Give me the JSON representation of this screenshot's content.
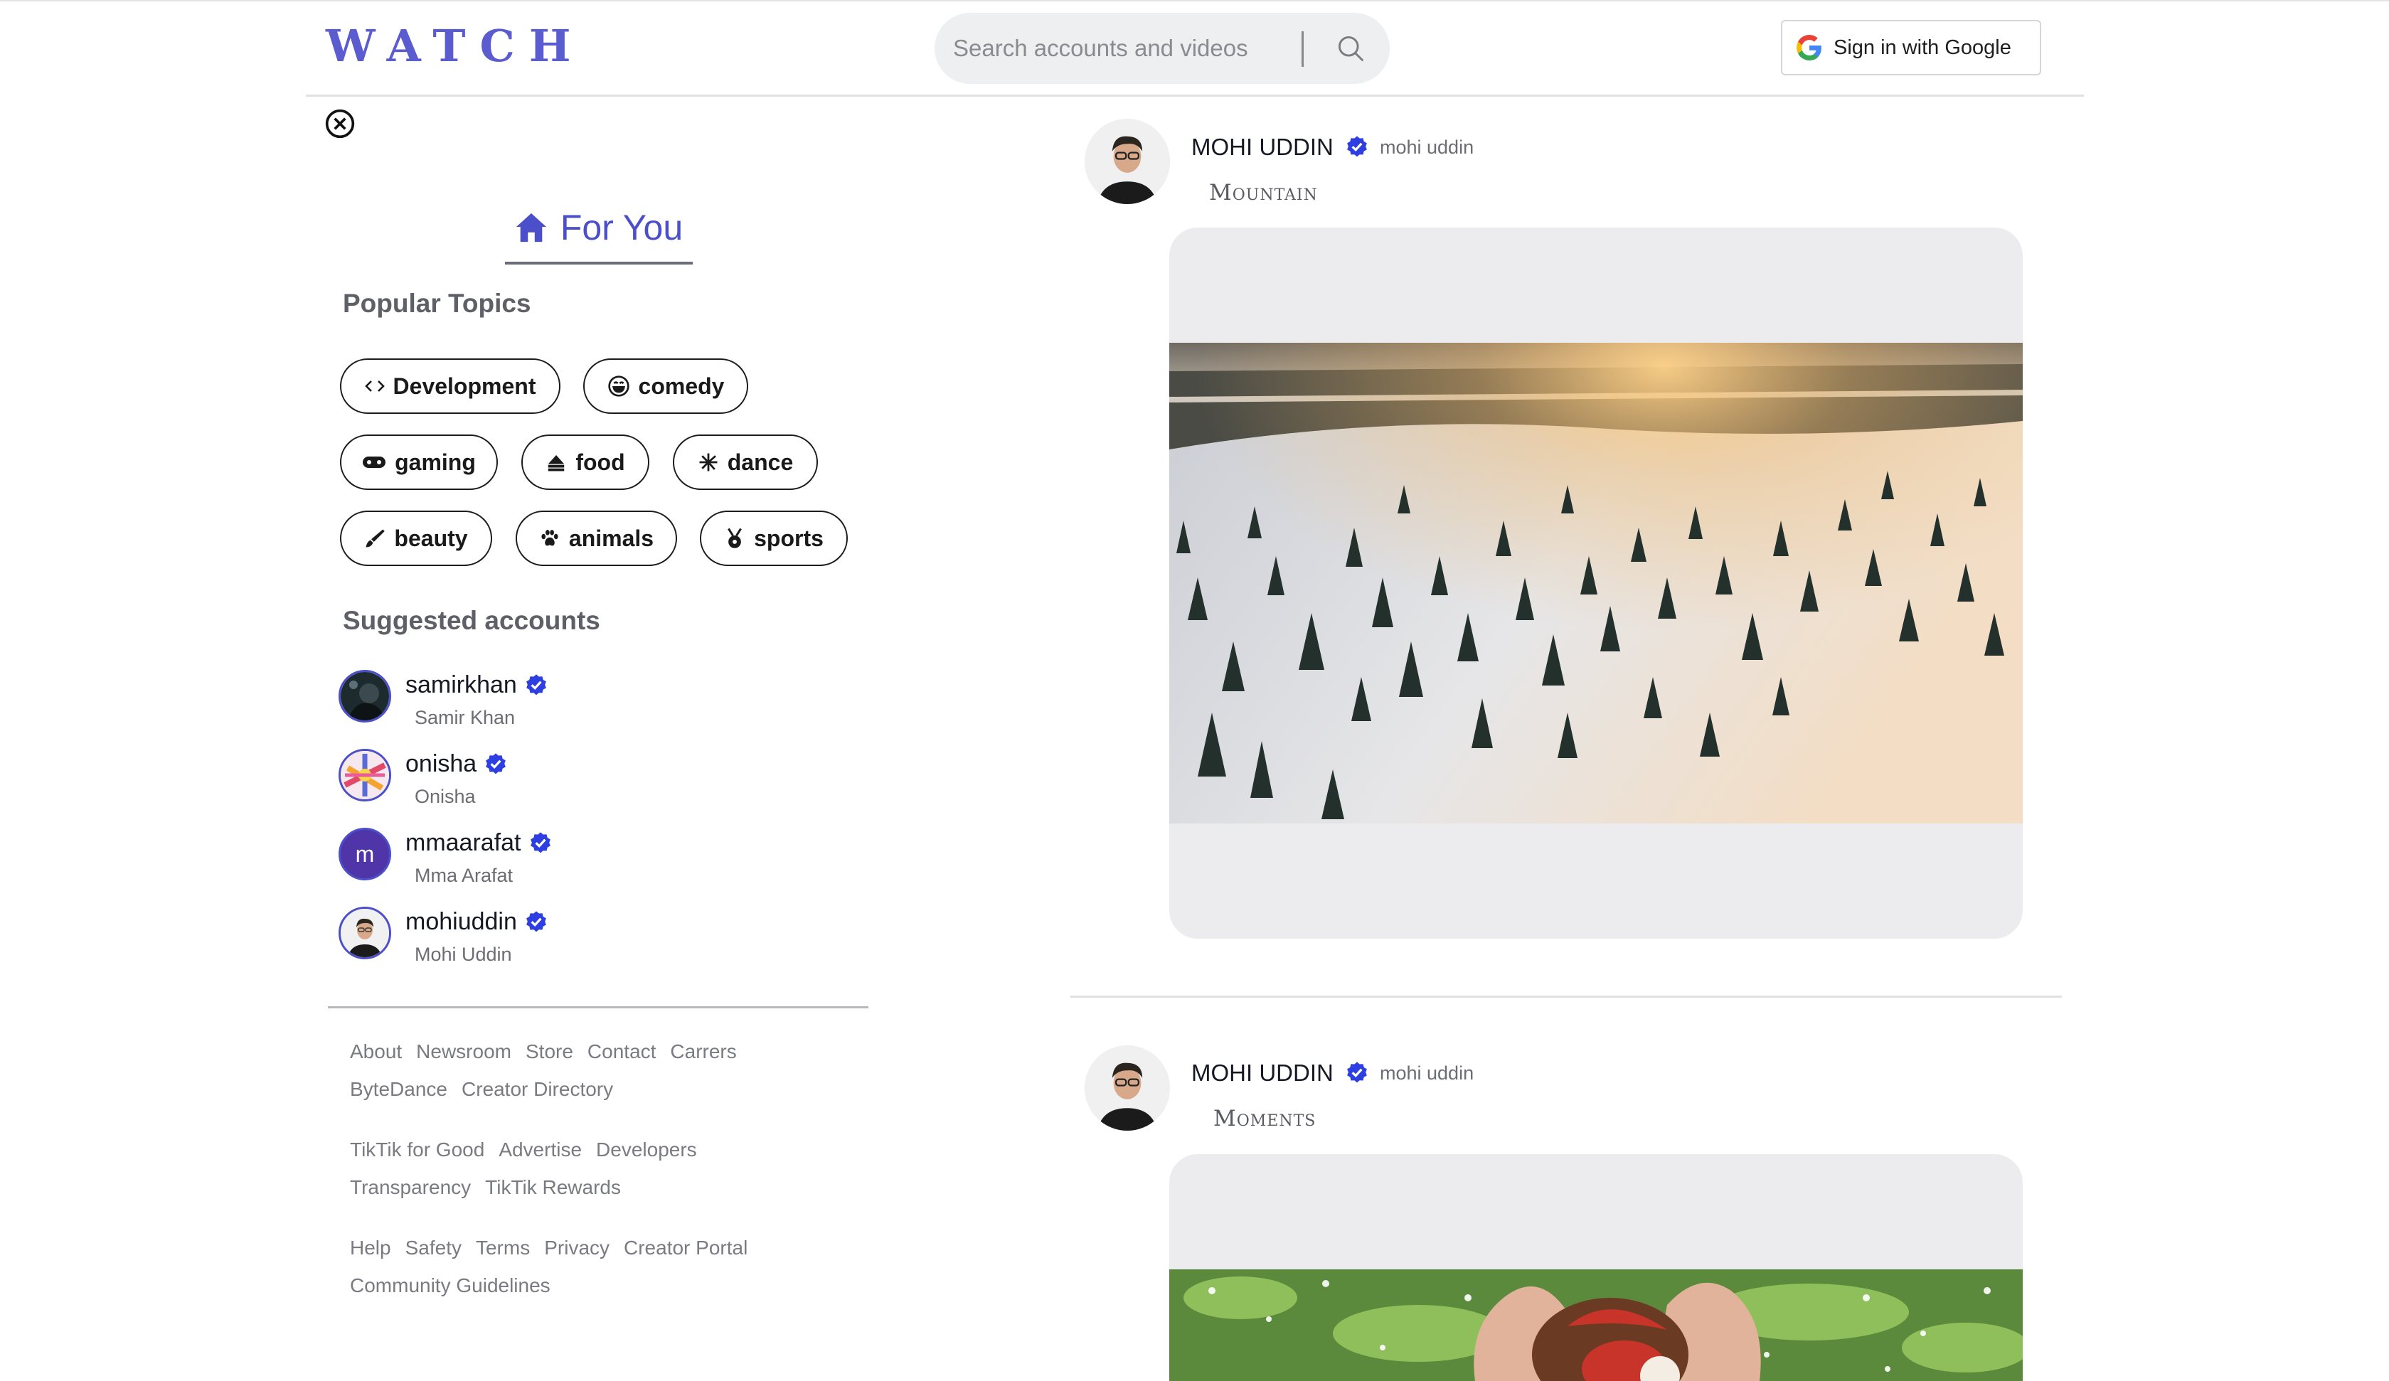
{
  "app": {
    "logo": "WATCH"
  },
  "search": {
    "placeholder": "Search accounts and videos"
  },
  "auth": {
    "google_label": "Sign in with Google"
  },
  "sidebar": {
    "for_you_label": "For You",
    "popular_topics_title": "Popular Topics",
    "topics": [
      {
        "label": "Development",
        "icon": "code-icon"
      },
      {
        "label": "comedy",
        "icon": "laugh-icon"
      },
      {
        "label": "gaming",
        "icon": "gamepad-icon"
      },
      {
        "label": "food",
        "icon": "cake-icon"
      },
      {
        "label": "dance",
        "icon": "dance-icon"
      },
      {
        "label": "beauty",
        "icon": "brush-icon"
      },
      {
        "label": "animals",
        "icon": "paw-icon"
      },
      {
        "label": "sports",
        "icon": "medal-icon"
      }
    ],
    "suggested_title": "Suggested accounts",
    "accounts": [
      {
        "username": "samirkhan",
        "name": "Samir Khan"
      },
      {
        "username": "onisha",
        "name": "Onisha"
      },
      {
        "username": "mmaarafat",
        "name": "Mma Arafat",
        "initial": "m"
      },
      {
        "username": "mohiuddin",
        "name": "Mohi Uddin"
      }
    ],
    "footer": [
      [
        "About",
        "Newsroom",
        "Store",
        "Contact",
        "Carrers"
      ],
      [
        "ByteDance",
        "Creator Directory"
      ],
      [
        "TikTik for Good",
        "Advertise",
        "Developers"
      ],
      [
        "Transparency",
        "TikTik Rewards"
      ],
      [
        "Help",
        "Safety",
        "Terms",
        "Privacy",
        "Creator Portal"
      ],
      [
        "Community Guidelines"
      ]
    ]
  },
  "feed": {
    "posts": [
      {
        "display_name": "MOHI UDDIN",
        "handle": "mohi uddin",
        "caption": "Mountain"
      },
      {
        "display_name": "MOHI UDDIN",
        "handle": "mohi uddin",
        "caption": "Moments"
      }
    ]
  },
  "colors": {
    "accent": "#4b4fc9",
    "verified": "#2d3fe0",
    "logo": "#5a5cd0"
  }
}
